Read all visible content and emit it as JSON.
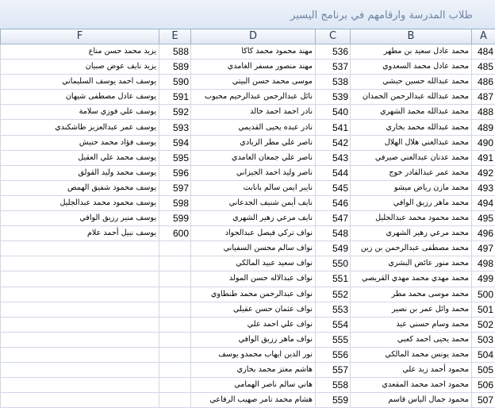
{
  "window": {
    "title": "طلاب المدرسة وارقامهم في برنامج اليسير"
  },
  "columns": [
    "A",
    "B",
    "C",
    "D",
    "E",
    "F"
  ],
  "rows": [
    {
      "a": "484",
      "b": "محمد عادل سعيد بن مطهر",
      "c": "536",
      "d": "مهند محمود محمد كاكا",
      "e": "588",
      "f": "يزيد محمد حسن مناع"
    },
    {
      "a": "485",
      "b": "محمد عادل محمد السعدوي",
      "c": "537",
      "d": "مهند منصور مسفر الغامدي",
      "e": "589",
      "f": "يزيد نايف عوض صبيان"
    },
    {
      "a": "486",
      "b": "محمد عبدالله حسين حبشي",
      "c": "538",
      "d": "موسى محمد حسن البيتي",
      "e": "590",
      "f": "يوسف احمد يوسف السليماني"
    },
    {
      "a": "487",
      "b": "محمد عبدالله عبدالرحمن الحمدان",
      "c": "539",
      "d": "نائل عبدالرحمن عبدالرحيم محبوب",
      "e": "591",
      "f": "يوسف عادل مصطفى شيهان"
    },
    {
      "a": "488",
      "b": "محمد عبدالله محمد الشهري",
      "c": "540",
      "d": "نادر احمد احمد خالد",
      "e": "592",
      "f": "يوسف علي فوزي سلامة"
    },
    {
      "a": "489",
      "b": "محمد عبدالله محمد بخاري",
      "c": "541",
      "d": "نادر عبده يحيى القديمي",
      "e": "593",
      "f": "يوسف عمر عبدالعزيز طاشكندي"
    },
    {
      "a": "490",
      "b": "محمد عبدالغني هلال الهلال",
      "c": "542",
      "d": "ناصر علي مطر الزبادي",
      "e": "594",
      "f": "يوسف فؤاد محمد حنيش"
    },
    {
      "a": "491",
      "b": "محمد عدنان عبدالغني صيرفي",
      "c": "543",
      "d": "ناصر علي جمعان الغامدي",
      "e": "595",
      "f": "يوسف محمد علي العقيل"
    },
    {
      "a": "492",
      "b": "محمد عمر عبدالقادر خوج",
      "c": "544",
      "d": "ناصر وليد احمد الجيزاني",
      "e": "596",
      "f": "يوسف محمد وليد القولق"
    },
    {
      "a": "493",
      "b": "محمد مازن رياض ميشو",
      "c": "545",
      "d": "نايبر ايمن سالم بانابت",
      "e": "597",
      "f": "يوسف محمود شفيق الهمص"
    },
    {
      "a": "494",
      "b": "محمد ماهر رزيق الوافي",
      "c": "546",
      "d": "نايف أيمن شنيف الجدعاني",
      "e": "598",
      "f": "يوسف محمود محمد عبدالجليل"
    },
    {
      "a": "495",
      "b": "محمد محمود محمد عبدالجليل",
      "c": "547",
      "d": "نايف مرعي زهير الشهري",
      "e": "599",
      "f": "يوسف منير رزيق الوافي"
    },
    {
      "a": "496",
      "b": "محمد مرعي زهير الشهري",
      "c": "548",
      "d": "نواف تركي فيصل عبدالجواد",
      "e": "600",
      "f": "يوسف نبيل أحمد علام"
    },
    {
      "a": "497",
      "b": "محمد مصطفى عبدالرحمن بن زين",
      "c": "549",
      "d": "نواف سالم محسن السفياني",
      "e": "",
      "f": ""
    },
    {
      "a": "498",
      "b": "محمد منور عائض البشري",
      "c": "550",
      "d": "نواف سعيد عبيد المالكي",
      "e": "",
      "f": ""
    },
    {
      "a": "499",
      "b": "محمد مهدي محمد مهدي القريصي",
      "c": "551",
      "d": "نواف عبدالاله حسن المولد",
      "e": "",
      "f": ""
    },
    {
      "a": "500",
      "b": "محمد موسى محمد مطر",
      "c": "552",
      "d": "نواف عبدالرحمن محمد طنطاوي",
      "e": "",
      "f": ""
    },
    {
      "a": "501",
      "b": "محمد وائل عمر بن نصير",
      "c": "553",
      "d": "نواف عثمان حسن عقيلي",
      "e": "",
      "f": ""
    },
    {
      "a": "502",
      "b": "محمد وسام حسني عيد",
      "c": "554",
      "d": "نواف علي احمد علي",
      "e": "",
      "f": ""
    },
    {
      "a": "503",
      "b": "محمد يحيى احمد كعبي",
      "c": "555",
      "d": "نواف ماهر رزيق الوافي",
      "e": "",
      "f": ""
    },
    {
      "a": "504",
      "b": "محمد يونس محمد المالكي",
      "c": "556",
      "d": "نور الدين ايهاب محمدو يوسف",
      "e": "",
      "f": ""
    },
    {
      "a": "505",
      "b": "محمود أحمد زيد علي",
      "c": "557",
      "d": "هاشم معتز محمد بخاري",
      "e": "",
      "f": ""
    },
    {
      "a": "506",
      "b": "محمود احمد محمد المقعدي",
      "c": "558",
      "d": "هاني سالم ناصر الهمامي",
      "e": "",
      "f": ""
    },
    {
      "a": "507",
      "b": "محمود جمال الياس قاسم",
      "c": "559",
      "d": "هشام محمد تامر صهيب الرفاعي",
      "e": "",
      "f": ""
    }
  ]
}
